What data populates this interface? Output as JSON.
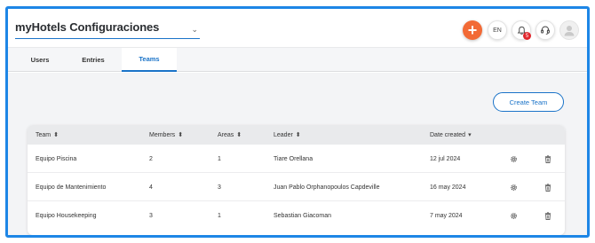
{
  "header": {
    "hotel_select_value": "myHotels Configuraciones",
    "add_label": "+",
    "language": "EN",
    "notification_count": "5",
    "icons": {
      "chevron": "chevron-down-icon",
      "notifications": "bell-icon",
      "support": "headset-icon",
      "avatar": "user-avatar-icon"
    }
  },
  "tabs": [
    {
      "label": "Users",
      "active": false
    },
    {
      "label": "Entries",
      "active": false
    },
    {
      "label": "Teams",
      "active": true
    }
  ],
  "toolbar": {
    "create_team_label": "Create Team"
  },
  "table": {
    "columns": {
      "team": "Team",
      "members": "Members",
      "areas": "Areas",
      "leader": "Leader",
      "date_created": "Date created"
    },
    "sorted_column": "date_created",
    "sort_direction": "desc",
    "rows": [
      {
        "team": "Equipo Piscina",
        "members": "2",
        "areas": "1",
        "leader": "Tiare Orellana",
        "date_created": "12 jul 2024"
      },
      {
        "team": "Equipo de Mantenimiento",
        "members": "4",
        "areas": "3",
        "leader": "Juan Pablo Orphanopoulos Capdeville",
        "date_created": "16 may 2024"
      },
      {
        "team": "Equipo Housekeeping",
        "members": "3",
        "areas": "1",
        "leader": "Sebastian Giacoman",
        "date_created": "7 may 2024"
      }
    ],
    "row_actions": [
      "gear-icon",
      "trash-icon"
    ]
  },
  "colors": {
    "accent": "#1a73c8",
    "frame": "#1d86e6",
    "add_button": "#f26a36",
    "badge": "#e0262c"
  }
}
